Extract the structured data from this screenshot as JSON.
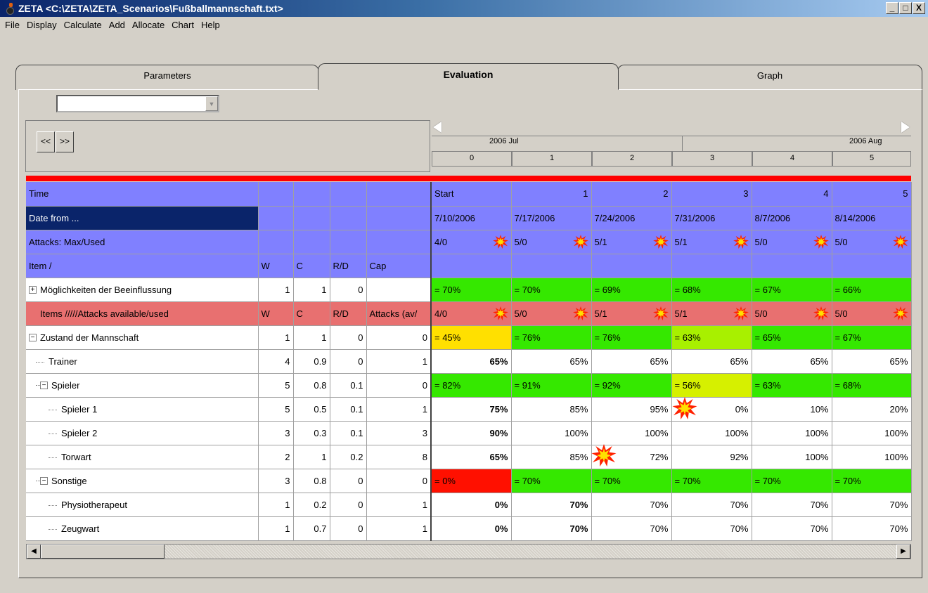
{
  "window": {
    "title": "ZETA <C:\\ZETA\\ZETA_Scenarios\\Fußballmannschaft.txt>",
    "minimize": "_",
    "maximize": "□",
    "close": "X"
  },
  "menu": [
    "File",
    "Display",
    "Calculate",
    "Add",
    "Allocate",
    "Chart",
    "Help"
  ],
  "tabs": {
    "parameters": "Parameters",
    "evaluation": "Evaluation",
    "graph": "Graph"
  },
  "nav": {
    "prev": "<<",
    "next": ">>"
  },
  "timeline": {
    "month1": "2006 Jul",
    "month2": "2006 Aug",
    "periods": [
      "0",
      "1",
      "2",
      "3",
      "4",
      "5"
    ]
  },
  "header_rows": {
    "time": {
      "label": "Time",
      "cols": [
        "Start",
        "1",
        "2",
        "3",
        "4",
        "5"
      ]
    },
    "date": {
      "label": "Date from ...",
      "cols": [
        "7/10/2006",
        "7/17/2006",
        "7/24/2006",
        "7/31/2006",
        "8/7/2006",
        "8/14/2006"
      ]
    },
    "attacks": {
      "label": "Attacks: Max/Used",
      "cols": [
        "4/0",
        "5/0",
        "5/1",
        "5/1",
        "5/0",
        "5/0"
      ]
    },
    "item": {
      "label": "Item /",
      "w": "W",
      "c": "C",
      "rd": "R/D",
      "cap": "Cap"
    }
  },
  "rows": {
    "moeg": {
      "label": "Möglichkeiten der Beeinflussung",
      "w": "1",
      "c": "1",
      "rd": "0",
      "cap": "",
      "cols": [
        "= 70%",
        "= 70%",
        "= 69%",
        "= 68%",
        "= 67%",
        "= 66%"
      ]
    },
    "items": {
      "label": "Items /////Attacks available/used",
      "w": "W",
      "c": "C",
      "rd": "R/D",
      "cap": "Attacks (av/",
      "cols": [
        "4/0",
        "5/0",
        "5/1",
        "5/1",
        "5/0",
        "5/0"
      ]
    },
    "zustand": {
      "label": "Zustand der Mannschaft",
      "w": "1",
      "c": "1",
      "rd": "0",
      "cap": "0",
      "cols": [
        "= 45%",
        "= 76%",
        "= 76%",
        "= 63%",
        "= 65%",
        "= 67%"
      ]
    },
    "trainer": {
      "label": "Trainer",
      "w": "4",
      "c": "0.9",
      "rd": "0",
      "cap": "1",
      "cols": [
        "65%",
        "65%",
        "65%",
        "65%",
        "65%",
        "65%"
      ]
    },
    "spieler": {
      "label": "Spieler",
      "w": "5",
      "c": "0.8",
      "rd": "0.1",
      "cap": "0",
      "cols": [
        "= 82%",
        "= 91%",
        "= 92%",
        "= 56%",
        "= 63%",
        "= 68%"
      ]
    },
    "spieler1": {
      "label": "Spieler 1",
      "w": "5",
      "c": "0.5",
      "rd": "0.1",
      "cap": "1",
      "cols": [
        "75%",
        "85%",
        "95%",
        "0%",
        "10%",
        "20%"
      ]
    },
    "spieler2": {
      "label": "Spieler 2",
      "w": "3",
      "c": "0.3",
      "rd": "0.1",
      "cap": "3",
      "cols": [
        "90%",
        "100%",
        "100%",
        "100%",
        "100%",
        "100%"
      ]
    },
    "torwart": {
      "label": "Torwart",
      "w": "2",
      "c": "1",
      "rd": "0.2",
      "cap": "8",
      "cols": [
        "65%",
        "85%",
        "72%",
        "92%",
        "100%",
        "100%"
      ]
    },
    "sonstige": {
      "label": "Sonstige",
      "w": "3",
      "c": "0.8",
      "rd": "0",
      "cap": "0",
      "cols": [
        "= 0%",
        "= 70%",
        "= 70%",
        "= 70%",
        "= 70%",
        "= 70%"
      ]
    },
    "physio": {
      "label": "Physiotherapeut",
      "w": "1",
      "c": "0.2",
      "rd": "0",
      "cap": "1",
      "cols": [
        "0%",
        "70%",
        "70%",
        "70%",
        "70%",
        "70%"
      ]
    },
    "zeugwart": {
      "label": "Zeugwart",
      "w": "1",
      "c": "0.7",
      "rd": "0",
      "cap": "1",
      "cols": [
        "0%",
        "70%",
        "70%",
        "70%",
        "70%",
        "70%"
      ]
    }
  },
  "tree_toggles": {
    "plus": "+",
    "minus": "−"
  },
  "scroll": {
    "left": "◀",
    "right": "▶"
  },
  "colors": {
    "header_blue": "#8080ff",
    "selected_navy": "#0a246a",
    "items_pink": "#e87070",
    "green": "#35e800",
    "yellow": "#ffe000",
    "red": "#ff1000",
    "lime": "#a8f000"
  }
}
